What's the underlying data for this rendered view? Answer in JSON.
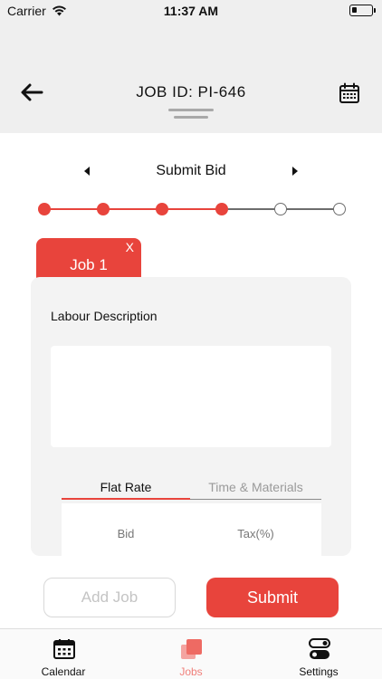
{
  "status_bar": {
    "carrier": "Carrier",
    "time": "11:37 AM"
  },
  "header": {
    "title": "JOB ID: PI-646",
    "back_icon": "arrow-left-icon",
    "calendar_icon": "calendar-icon"
  },
  "step_nav": {
    "title": "Submit Bid",
    "prev_icon": "triangle-left-icon",
    "next_icon": "triangle-right-icon"
  },
  "progress": {
    "total_steps": 6,
    "completed_steps": 4
  },
  "job_tab": {
    "label": "Job 1",
    "close": "X"
  },
  "card": {
    "labour_label": "Labour Description",
    "labour_value": "",
    "rate_tabs": [
      {
        "label": "Flat Rate",
        "active": true
      },
      {
        "label": "Time & Materials",
        "active": false
      }
    ],
    "columns": {
      "bid": "Bid",
      "tax": "Tax(%)"
    }
  },
  "actions": {
    "add_job": "Add Job",
    "submit": "Submit"
  },
  "bottom_nav": {
    "items": [
      {
        "label": "Calendar",
        "icon": "calendar-icon",
        "active": false
      },
      {
        "label": "Jobs",
        "icon": "jobs-stack-icon",
        "active": true
      },
      {
        "label": "Settings",
        "icon": "toggle-settings-icon",
        "active": false
      }
    ]
  },
  "colors": {
    "accent": "#e8443c",
    "accent_light": "#f07f7a",
    "header_bg": "#efefef",
    "card_bg": "#f3f3f3"
  }
}
